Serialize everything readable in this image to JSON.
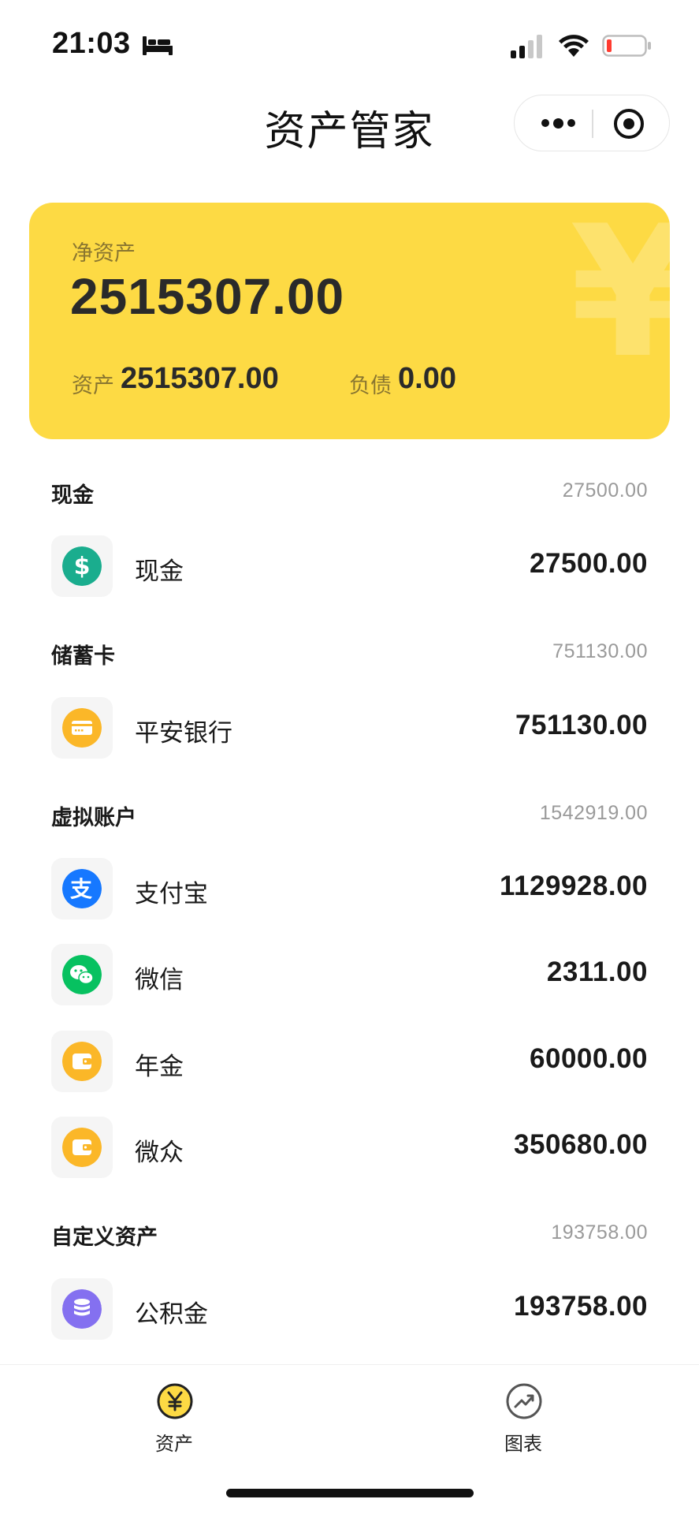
{
  "status_bar": {
    "time": "21:03"
  },
  "header": {
    "title": "资产管家"
  },
  "summary": {
    "net_label": "净资产",
    "net_value": "2515307.00",
    "assets_label": "资产",
    "assets_value": "2515307.00",
    "liabilities_label": "负债",
    "liabilities_value": "0.00"
  },
  "sections": [
    {
      "title": "现金",
      "total": "27500.00",
      "items": [
        {
          "name": "现金",
          "value": "27500.00",
          "icon": "dollar-icon",
          "color": "#1aad8e"
        }
      ]
    },
    {
      "title": "储蓄卡",
      "total": "751130.00",
      "items": [
        {
          "name": "平安银行",
          "value": "751130.00",
          "icon": "card-icon",
          "color": "#fbb728"
        }
      ]
    },
    {
      "title": "虚拟账户",
      "total": "1542919.00",
      "items": [
        {
          "name": "支付宝",
          "value": "1129928.00",
          "icon": "alipay-icon",
          "color": "#1678ff"
        },
        {
          "name": "微信",
          "value": "2311.00",
          "icon": "wechat-icon",
          "color": "#07c160"
        },
        {
          "name": "年金",
          "value": "60000.00",
          "icon": "wallet-icon",
          "color": "#fbb728"
        },
        {
          "name": "微众",
          "value": "350680.00",
          "icon": "wallet-icon",
          "color": "#fbb728"
        }
      ]
    },
    {
      "title": "自定义资产",
      "total": "193758.00",
      "items": [
        {
          "name": "公积金",
          "value": "193758.00",
          "icon": "coins-icon",
          "color": "#8470f0"
        }
      ]
    }
  ],
  "tab_bar": {
    "tabs": [
      {
        "label": "资产",
        "icon": "yen-icon",
        "active": true
      },
      {
        "label": "图表",
        "icon": "chart-icon",
        "active": false
      }
    ]
  },
  "colors": {
    "card_bg": "#fdda44",
    "accent": "#fdda44",
    "muted_text": "#9a9a9a"
  }
}
